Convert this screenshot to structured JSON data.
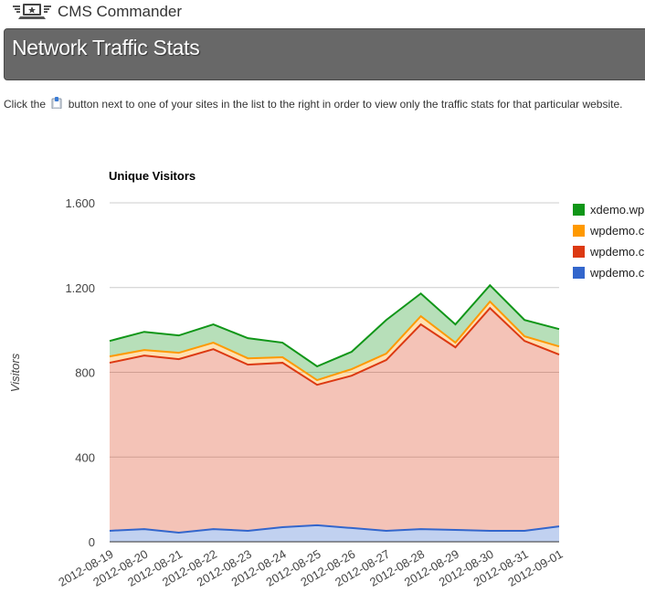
{
  "app": {
    "brand": "CMS Commander",
    "logo_icon": "star-laptop-logo-icon"
  },
  "header": {
    "title": "Network Traffic Stats"
  },
  "description": {
    "before_icon": "Click the",
    "icon": "site-stats-button-icon",
    "after_icon": "button next to one of your sites in the list to the right in order to view only the traffic stats for that particular website."
  },
  "chart_data": {
    "type": "area",
    "stacked": true,
    "title": "Unique Visitors",
    "xlabel": "",
    "ylabel": "Visitors",
    "ylim": [
      0,
      1600
    ],
    "yticks": [
      0,
      400,
      800,
      1200,
      1600
    ],
    "ytick_labels": [
      "0",
      "400",
      "800",
      "1.200",
      "1.600"
    ],
    "grid": true,
    "legend_position": "right",
    "categories": [
      "2012-08-19",
      "2012-08-20",
      "2012-08-21",
      "2012-08-22",
      "2012-08-23",
      "2012-08-24",
      "2012-08-25",
      "2012-08-26",
      "2012-08-27",
      "2012-08-28",
      "2012-08-29",
      "2012-08-30",
      "2012-08-31",
      "2012-09-01"
    ],
    "series": [
      {
        "name": "wpdemo.c",
        "color": "#3366cc",
        "values": [
          52,
          60,
          43,
          60,
          52,
          69,
          78,
          65,
          52,
          60,
          56,
          52,
          52,
          73
        ]
      },
      {
        "name": "wpdemo.c",
        "color": "#dc3912",
        "values": [
          793,
          819,
          819,
          849,
          784,
          776,
          663,
          719,
          806,
          966,
          862,
          1051,
          896,
          811
        ]
      },
      {
        "name": "wpdemo.c",
        "color": "#ff9900",
        "values": [
          30,
          26,
          30,
          31,
          30,
          26,
          22,
          31,
          30,
          39,
          22,
          31,
          22,
          38
        ]
      },
      {
        "name": "xdemo.wp",
        "color": "#109618",
        "values": [
          73,
          86,
          82,
          86,
          95,
          69,
          65,
          82,
          159,
          107,
          86,
          77,
          77,
          82
        ]
      }
    ],
    "legend_order": [
      "xdemo.wp",
      "wpdemo.c",
      "wpdemo.c",
      "wpdemo.c"
    ]
  }
}
